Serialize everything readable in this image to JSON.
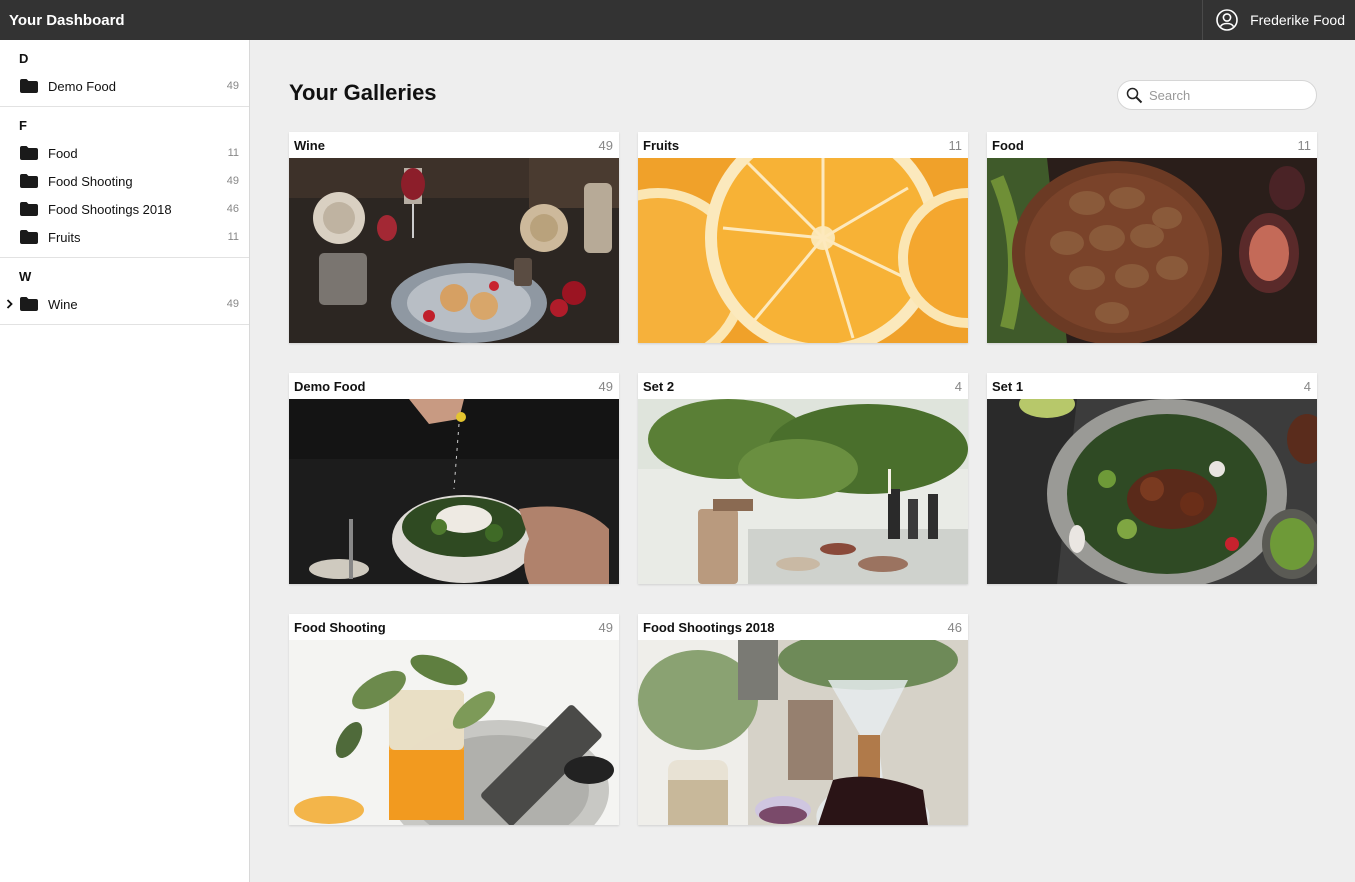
{
  "app": {
    "title": "Your Dashboard"
  },
  "user": {
    "name": "Frederike Food",
    "icon": "user-circle-icon"
  },
  "sidebar": {
    "groups": [
      {
        "letter": "D",
        "items": [
          {
            "label": "Demo Food",
            "count": "49"
          }
        ]
      },
      {
        "letter": "F",
        "items": [
          {
            "label": "Food",
            "count": "11"
          },
          {
            "label": "Food Shooting",
            "count": "49"
          },
          {
            "label": "Food Shootings 2018",
            "count": "46"
          },
          {
            "label": "Fruits",
            "count": "11"
          }
        ]
      },
      {
        "letter": "W",
        "items": [
          {
            "label": "Wine",
            "count": "49",
            "expandable": true
          }
        ]
      }
    ]
  },
  "main": {
    "title": "Your Galleries",
    "search_placeholder": "Search"
  },
  "galleries": [
    {
      "name": "Wine",
      "count": "49"
    },
    {
      "name": "Fruits",
      "count": "11"
    },
    {
      "name": "Food",
      "count": "11"
    },
    {
      "name": "Demo Food",
      "count": "49"
    },
    {
      "name": "Set 2",
      "count": "4"
    },
    {
      "name": "Set 1",
      "count": "4"
    },
    {
      "name": "Food Shooting",
      "count": "49"
    },
    {
      "name": "Food Shootings 2018",
      "count": "46"
    }
  ],
  "colors": {
    "topbar": "#333333",
    "background": "#eeeeee",
    "sidebar": "#ffffff",
    "orange": "#f5a623"
  }
}
